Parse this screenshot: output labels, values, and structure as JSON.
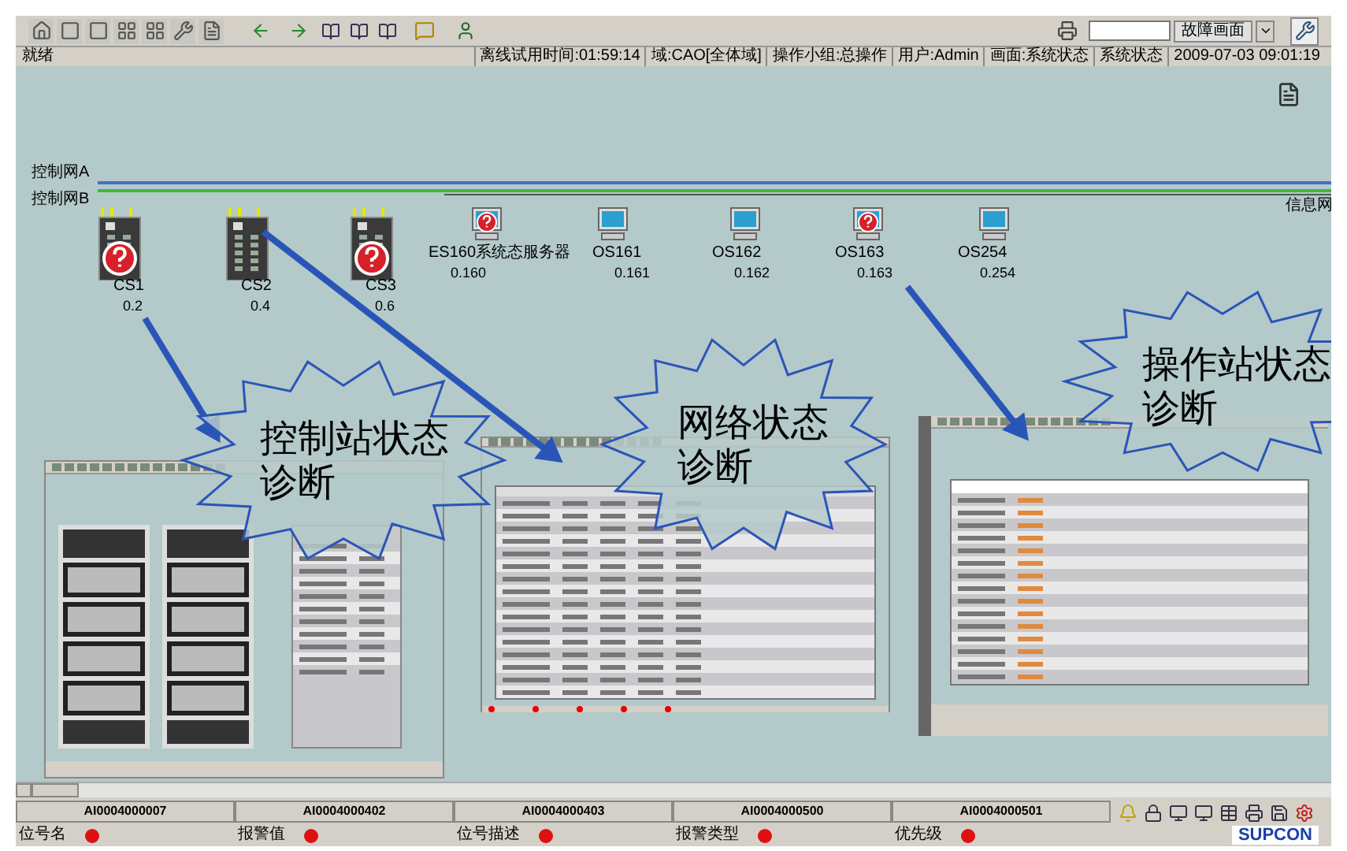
{
  "toolbar": {
    "view_selector": "故障画面"
  },
  "status_line": {
    "left": "就绪",
    "items": [
      "离线试用时间:01:59:14",
      "域:CAO[全体域]",
      "操作小组:总操作",
      "用户:Admin",
      "画面:系统状态",
      "系统状态",
      "2009-07-03 09:01:19"
    ]
  },
  "canvas": {
    "networks": [
      {
        "label": "控制网A",
        "kind": "control_a"
      },
      {
        "label": "控制网B",
        "kind": "control_b"
      }
    ],
    "info_network": "信息网",
    "nodes": [
      {
        "kind": "controller",
        "name": "CS1",
        "address": "0.2",
        "fault": true
      },
      {
        "kind": "controller",
        "name": "CS2",
        "address": "0.4",
        "fault": false
      },
      {
        "kind": "controller",
        "name": "CS3",
        "address": "0.6",
        "fault": true
      },
      {
        "kind": "station",
        "name": "ES160系统态服务器",
        "address": "0.160",
        "fault": true
      },
      {
        "kind": "station",
        "name": "OS161",
        "address": "0.161",
        "fault": false
      },
      {
        "kind": "station",
        "name": "OS162",
        "address": "0.162",
        "fault": false
      },
      {
        "kind": "station",
        "name": "OS163",
        "address": "0.163",
        "fault": true
      },
      {
        "kind": "station",
        "name": "OS254",
        "address": "0.254",
        "fault": false
      }
    ]
  },
  "callouts": [
    {
      "text": "控制站状态诊断"
    },
    {
      "text": "网络状态诊断"
    },
    {
      "text": "操作站状态诊断"
    }
  ],
  "alarm_tabs": [
    "AI0004000007",
    "AI0004000402",
    "AI0004000403",
    "AI0004000500",
    "AI0004000501"
  ],
  "alarm_columns": [
    "位号名",
    "报警值",
    "位号描述",
    "报警类型",
    "优先级"
  ],
  "logo": "SUPCON"
}
